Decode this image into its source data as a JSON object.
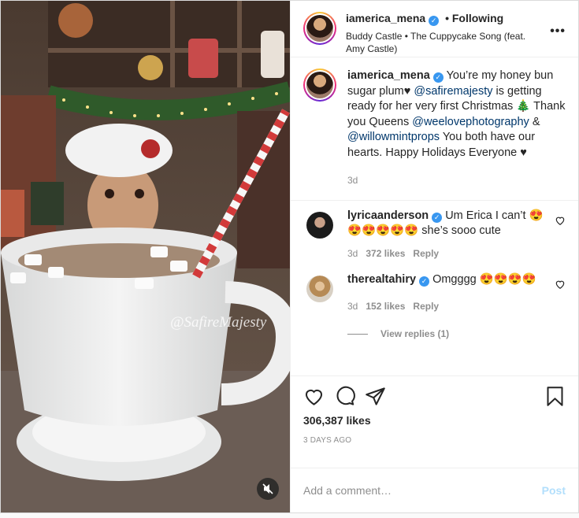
{
  "header": {
    "username": "iamerica_mena",
    "follow_label": "• Following",
    "song": "Buddy Castle • The Cuppycake Song (feat. Amy Castle)",
    "more_icon": "more-dots-icon"
  },
  "caption": {
    "username": "iamerica_mena",
    "text_1": "You’re my honey bun sugar plum♥",
    "mention_1": "@safiremajesty",
    "text_2": "is getting ready for her very first Christmas 🎄 Thank you Queens",
    "mention_2": "@weelovephotography",
    "text_3": "&",
    "mention_3": "@willowmintprops",
    "text_4": "You both have our hearts. Happy Holidays Everyone ♥",
    "age": "3d"
  },
  "comments": [
    {
      "username": "lyricaanderson",
      "text": "Um Erica I can’t 😍😍😍😍😍😍 she’s sooo cute",
      "age": "3d",
      "likes": "372 likes",
      "reply": "Reply"
    },
    {
      "username": "therealtahiry",
      "text": "Omgggg 😍😍😍😍",
      "age": "3d",
      "likes": "152 likes",
      "reply": "Reply",
      "view_replies": "View replies (1)"
    }
  ],
  "actions": {
    "likes": "306,387 likes",
    "date": "3 DAYS AGO"
  },
  "add_comment": {
    "placeholder": "Add a comment…",
    "post_label": "Post"
  },
  "media": {
    "watermark": "@SafireMajesty"
  },
  "colors": {
    "link": "#00376b",
    "verified": "#3897f0",
    "post_disabled": "#b2dffc"
  }
}
